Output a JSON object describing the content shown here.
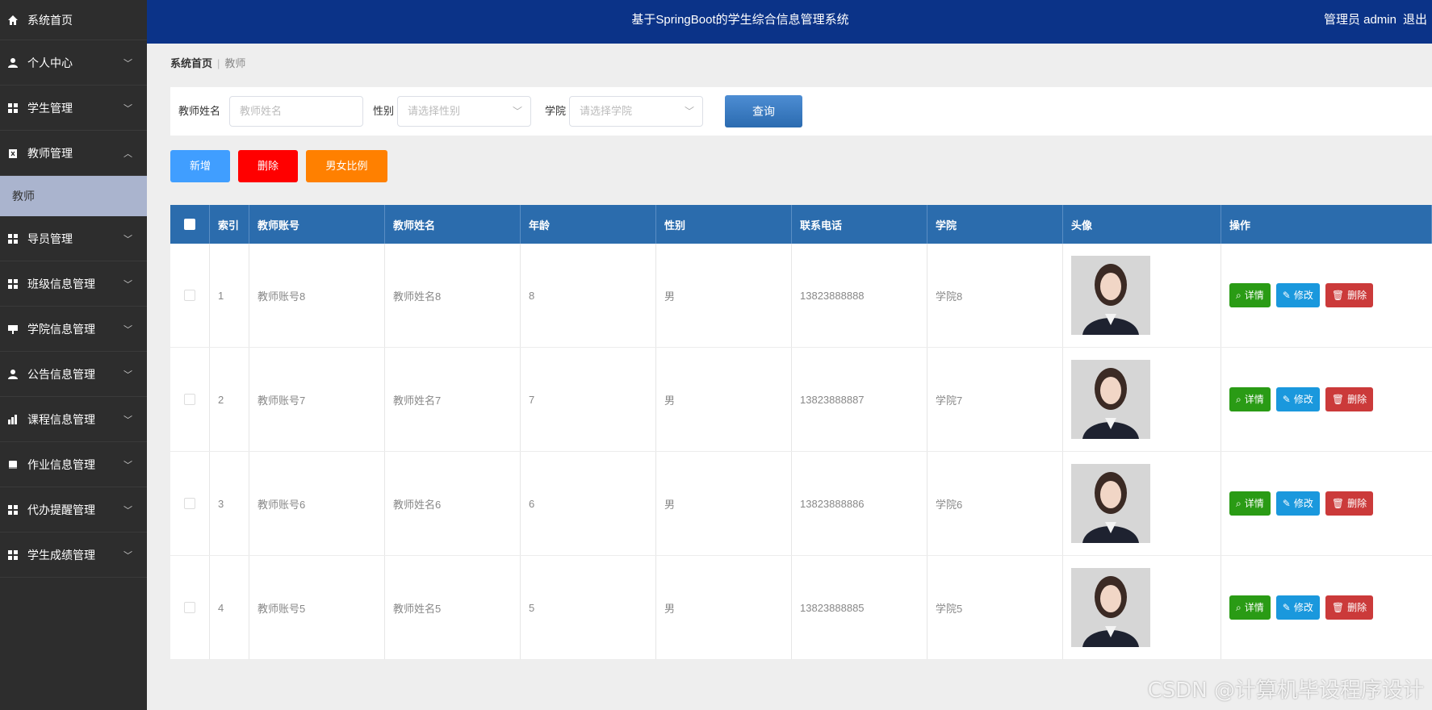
{
  "sidebar": {
    "home": "系统首页",
    "items": [
      {
        "label": "个人中心"
      },
      {
        "label": "学生管理"
      },
      {
        "label": "教师管理"
      },
      {
        "label": "导员管理"
      },
      {
        "label": "班级信息管理"
      },
      {
        "label": "学院信息管理"
      },
      {
        "label": "公告信息管理"
      },
      {
        "label": "课程信息管理"
      },
      {
        "label": "作业信息管理"
      },
      {
        "label": "代办提醒管理"
      },
      {
        "label": "学生成绩管理"
      }
    ],
    "active_sub": "教师"
  },
  "header": {
    "title": "基于SpringBoot的学生综合信息管理系统",
    "user": "管理员 admin",
    "logout": "退出"
  },
  "breadcrumb": {
    "home": "系统首页",
    "current": "教师"
  },
  "filter": {
    "name_label": "教师姓名",
    "name_placeholder": "教师姓名",
    "gender_label": "性别",
    "gender_placeholder": "请选择性别",
    "college_label": "学院",
    "college_placeholder": "请选择学院",
    "query": "查询"
  },
  "actions": {
    "add": "新增",
    "delete": "删除",
    "ratio": "男女比例"
  },
  "table": {
    "headers": [
      "索引",
      "教师账号",
      "教师姓名",
      "年龄",
      "性别",
      "联系电话",
      "学院",
      "头像",
      "操作"
    ],
    "rows": [
      {
        "index": "1",
        "account": "教师账号8",
        "name": "教师姓名8",
        "age": "8",
        "gender": "男",
        "phone": "13823888888",
        "college": "学院8"
      },
      {
        "index": "2",
        "account": "教师账号7",
        "name": "教师姓名7",
        "age": "7",
        "gender": "男",
        "phone": "13823888887",
        "college": "学院7"
      },
      {
        "index": "3",
        "account": "教师账号6",
        "name": "教师姓名6",
        "age": "6",
        "gender": "男",
        "phone": "13823888886",
        "college": "学院6"
      },
      {
        "index": "4",
        "account": "教师账号5",
        "name": "教师姓名5",
        "age": "5",
        "gender": "男",
        "phone": "13823888885",
        "college": "学院5"
      }
    ],
    "op_detail": "详情",
    "op_edit": "修改",
    "op_delete": "删除"
  },
  "watermark": "CSDN @计算机毕设程序设计",
  "colors": {
    "header": "#0b3388",
    "sidebar": "#2d2d2d",
    "table_head": "#2b6cad",
    "add": "#409eff",
    "delete": "#ff0000",
    "ratio": "#ff8000"
  }
}
